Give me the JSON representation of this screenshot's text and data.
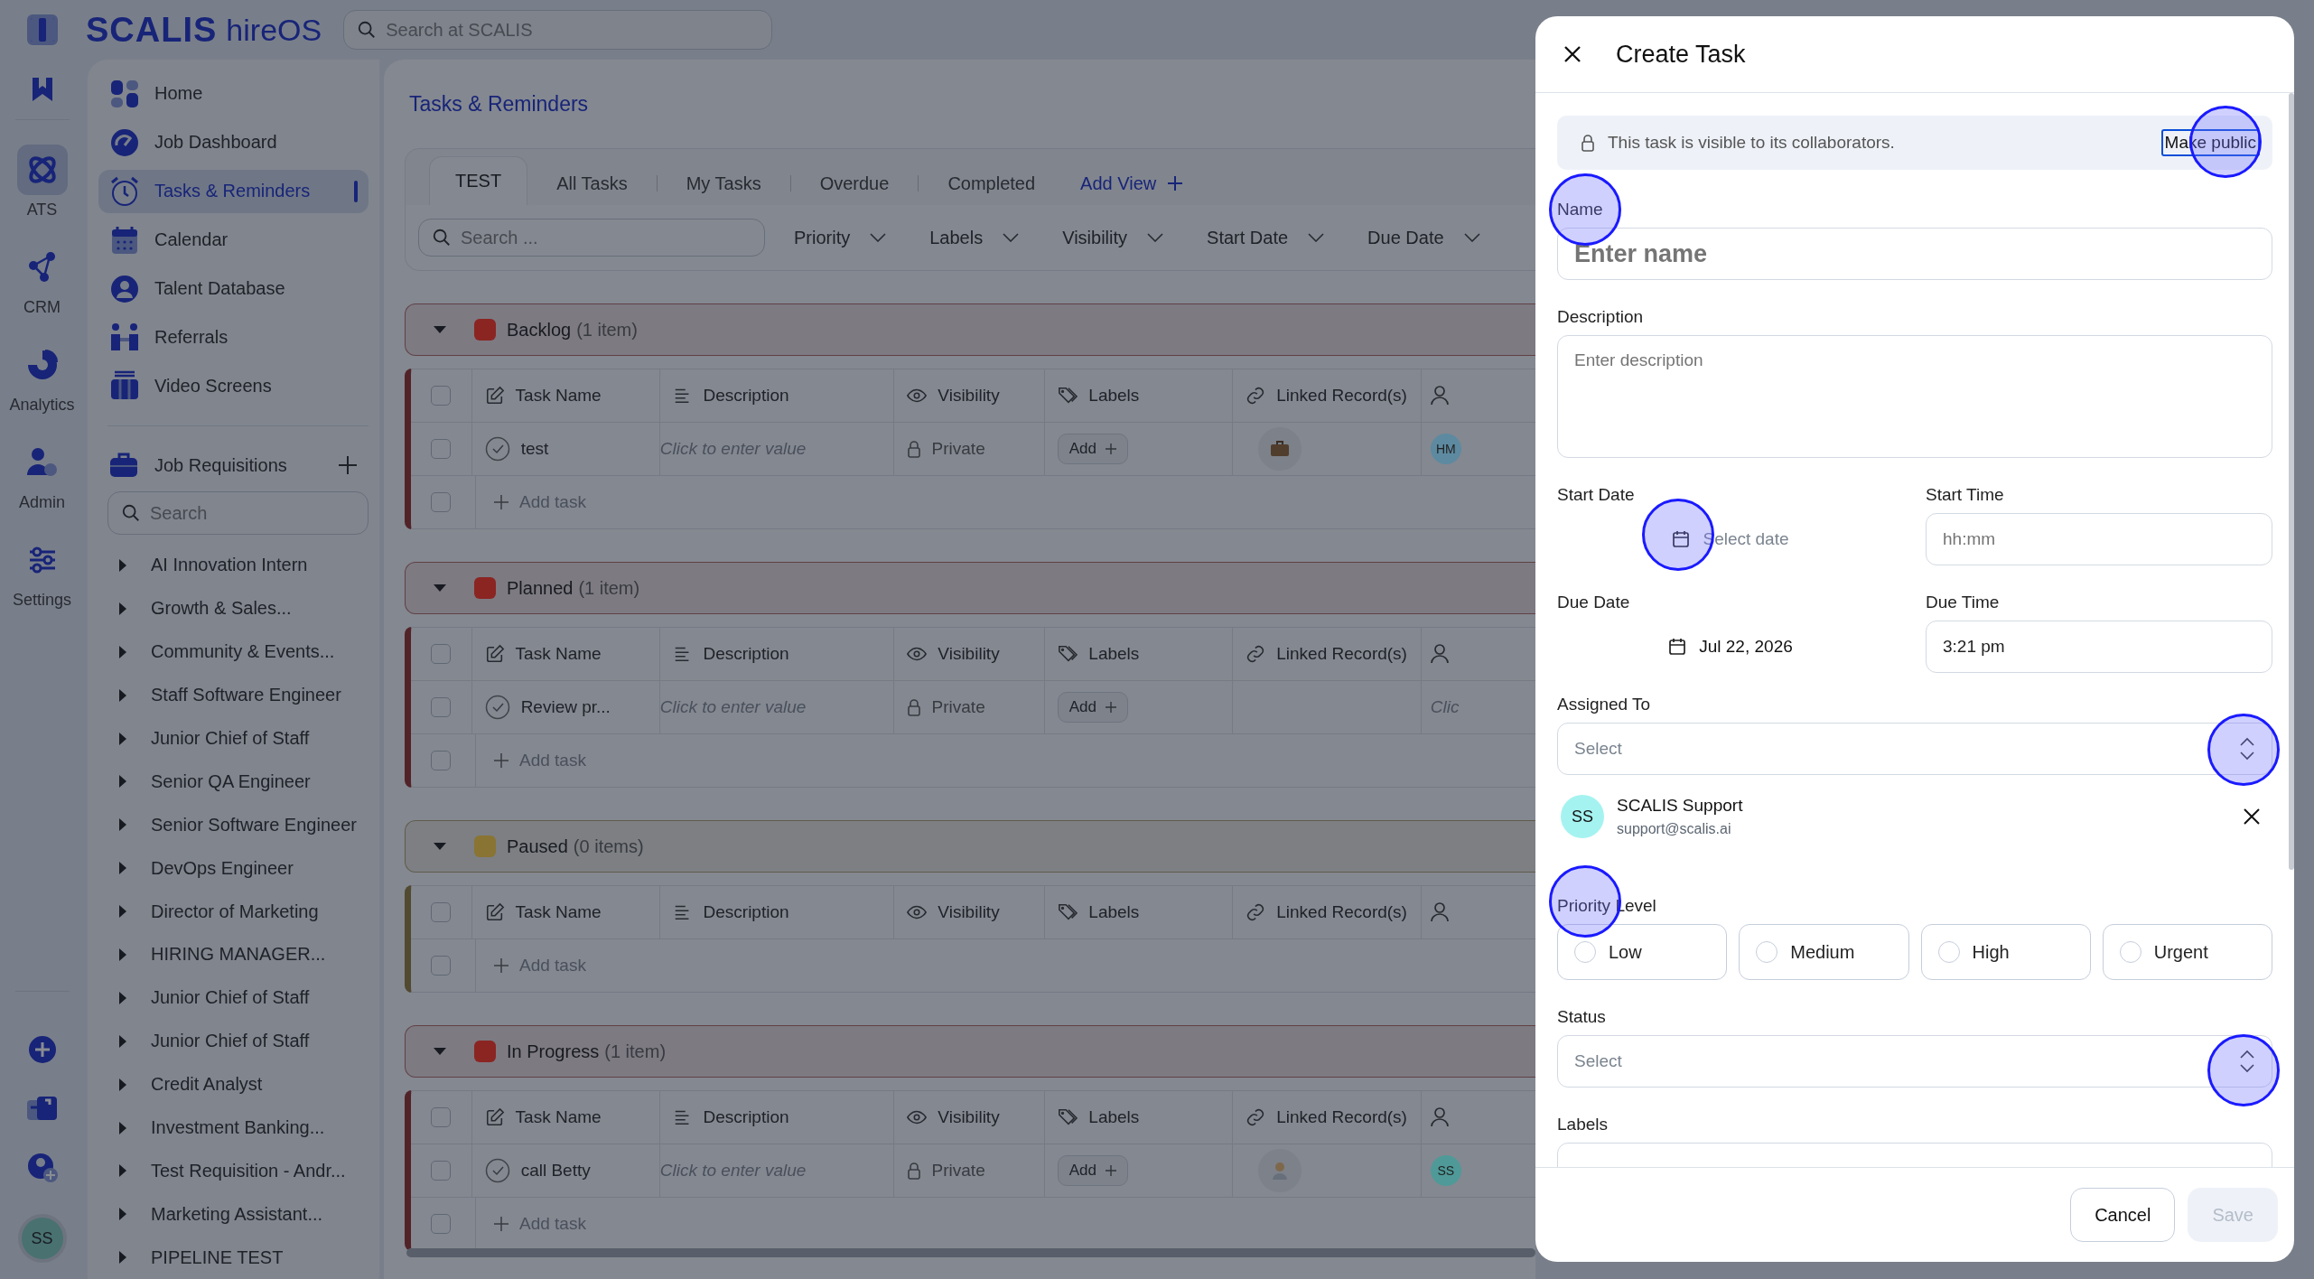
{
  "topbar": {
    "logo": "SCALIS",
    "product": "hireOS",
    "search_placeholder": "Search at SCALIS"
  },
  "rail": {
    "items": [
      {
        "label": "ATS",
        "selected": true
      },
      {
        "label": "CRM",
        "selected": false
      },
      {
        "label": "Analytics",
        "selected": false
      },
      {
        "label": "Admin",
        "selected": false
      },
      {
        "label": "Settings",
        "selected": false
      }
    ],
    "avatar": "SS"
  },
  "sidebar": {
    "items": [
      {
        "label": "Home",
        "selected": false
      },
      {
        "label": "Job Dashboard",
        "selected": false
      },
      {
        "label": "Tasks & Reminders",
        "selected": true
      },
      {
        "label": "Calendar",
        "selected": false
      },
      {
        "label": "Talent Database",
        "selected": false
      },
      {
        "label": "Referrals",
        "selected": false
      },
      {
        "label": "Video Screens",
        "selected": false
      }
    ],
    "section": "Job Requisitions",
    "search_placeholder": "Search",
    "requisitions": [
      "AI Innovation Intern",
      "Growth & Sales...",
      "Community & Events...",
      "Staff Software Engineer",
      "Junior Chief of Staff",
      "Senior QA Engineer",
      "Senior Software Engineer",
      "DevOps Engineer",
      "Director of Marketing",
      "HIRING MANAGER...",
      "Junior Chief of Staff",
      "Junior Chief of Staff",
      "Credit Analyst",
      "Investment Banking...",
      "Test Requisition - Andr...",
      "Marketing Assistant...",
      "PIPELINE TEST"
    ]
  },
  "page": {
    "title": "Tasks & Reminders",
    "tabs": [
      {
        "label": "TEST",
        "selected": true
      },
      {
        "label": "All Tasks",
        "selected": false
      },
      {
        "label": "My Tasks",
        "selected": false
      },
      {
        "label": "Overdue",
        "selected": false
      },
      {
        "label": "Completed",
        "selected": false
      }
    ],
    "add_view": "Add View",
    "search_placeholder": "Search ...",
    "filters": [
      "Priority",
      "Labels",
      "Visibility",
      "Start Date",
      "Due Date"
    ]
  },
  "groups": [
    {
      "name": "Backlog",
      "count": "(1 item)",
      "color": "#8b2522",
      "expanded": true,
      "all_checked": false,
      "new_row_checked": false,
      "columns": [
        "Task Name",
        "Description",
        "Visibility",
        "Labels",
        "Linked Record(s)"
      ],
      "rows": [
        {
          "checked": false,
          "name": "test",
          "description": "Click to enter value",
          "visibility": "Private",
          "labels": "Add",
          "linked": {
            "kind": "job"
          },
          "assignee": {
            "kind": "avatar",
            "text": "HM",
            "color": "#5d8aa0"
          }
        }
      ],
      "add_task": "Add task"
    },
    {
      "name": "Planned",
      "count": "(1 item)",
      "color": "#8b2522",
      "expanded": true,
      "all_checked": false,
      "new_row_checked": false,
      "columns": [
        "Task Name",
        "Description",
        "Visibility",
        "Labels",
        "Linked Record(s)"
      ],
      "rows": [
        {
          "checked": false,
          "name": "Review pr...",
          "description": "Click to enter value",
          "visibility": "Private",
          "labels": "Add",
          "assignee": {
            "kind": "placeholder",
            "text": "Clic"
          }
        }
      ],
      "add_task": "Add task"
    },
    {
      "name": "Paused",
      "count": "(0 items)",
      "color": "#8a7433",
      "expanded": true,
      "all_checked": false,
      "new_row_checked": false,
      "columns": [
        "Task Name",
        "Description",
        "Visibility",
        "Labels",
        "Linked Record(s)"
      ],
      "add_task": "Add task"
    },
    {
      "name": "In Progress",
      "count": "(1 item)",
      "color": "#8b2522",
      "expanded": true,
      "all_checked": false,
      "new_row_checked": false,
      "columns": [
        "Task Name",
        "Description",
        "Visibility",
        "Labels",
        "Linked Record(s)"
      ],
      "rows": [
        {
          "checked": false,
          "name": "call Betty",
          "description": "Click to enter value",
          "visibility": "Private",
          "labels": "Add",
          "linked": {
            "kind": "person"
          },
          "assignee": {
            "kind": "avatar",
            "text": "SS",
            "color": "#4f9a98"
          }
        }
      ],
      "add_task": "Add task"
    }
  ],
  "dialog": {
    "title": "Create Task",
    "notice": "This task is visible to its collaborators.",
    "notice_action": "Make public",
    "name": {
      "label": "Name",
      "placeholder": "Enter name"
    },
    "description": {
      "label": "Description",
      "placeholder": "Enter description"
    },
    "start_date": {
      "label": "Start Date",
      "placeholder": "Select date"
    },
    "start_time": {
      "label": "Start Time",
      "placeholder": "hh:mm"
    },
    "due_date": {
      "label": "Due Date",
      "value": "Jul 22, 2026"
    },
    "due_time": {
      "label": "Due Time",
      "value": "3:21 pm"
    },
    "assigned_to": {
      "label": "Assigned To",
      "placeholder": "Select"
    },
    "assignees": [
      {
        "initials": "SS",
        "name": "SCALIS Support",
        "email": "support@scalis.ai"
      }
    ],
    "priority": {
      "label": "Priority Level",
      "options": [
        {
          "label": "Low",
          "selected": false
        },
        {
          "label": "Medium",
          "selected": false
        },
        {
          "label": "High",
          "selected": false
        },
        {
          "label": "Urgent",
          "selected": false
        }
      ]
    },
    "status": {
      "label": "Status",
      "placeholder": "Select"
    },
    "labels": {
      "label": "Labels"
    },
    "cancel": "Cancel",
    "save": {
      "label": "Save",
      "disabled": true
    }
  }
}
